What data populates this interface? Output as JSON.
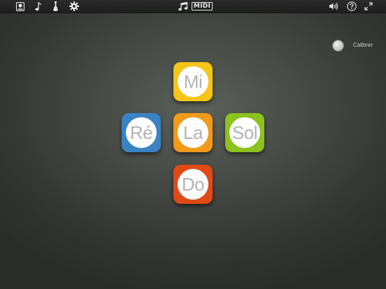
{
  "toolbar": {
    "left_icons": [
      "tuner-icon",
      "music-note-icon",
      "guitar-icon",
      "gear-icon"
    ],
    "center_icons": [
      "music-notes-icon",
      "midi-icon"
    ],
    "midi_label": "MIDI",
    "right_icons": [
      "speaker-icon",
      "help-icon",
      "fullscreen-icon"
    ]
  },
  "calibrate": {
    "label": "Calibrer"
  },
  "notes": [
    {
      "name": "mi",
      "label": "Mi",
      "color": "#f5c518"
    },
    {
      "name": "re",
      "label": "Ré",
      "color": "#3a82c4"
    },
    {
      "name": "la",
      "label": "La",
      "color": "#f29a1a"
    },
    {
      "name": "sol",
      "label": "Sol",
      "color": "#8cc21e"
    },
    {
      "name": "do",
      "label": "Do",
      "color": "#e04a17"
    }
  ]
}
